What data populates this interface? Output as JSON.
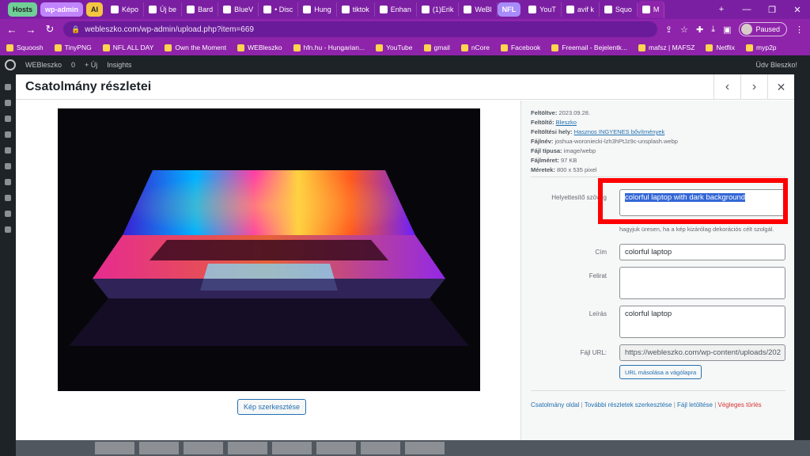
{
  "browser": {
    "tabs": [
      {
        "label": "Hosts",
        "kind": "group g1"
      },
      {
        "label": "wp-admin",
        "kind": "group g2"
      },
      {
        "label": "AI",
        "kind": "group g3"
      },
      {
        "label": "Képo",
        "kind": ""
      },
      {
        "label": "Új be",
        "kind": ""
      },
      {
        "label": "Bard",
        "kind": ""
      },
      {
        "label": "BlueV",
        "kind": ""
      },
      {
        "label": "• Disc",
        "kind": ""
      },
      {
        "label": "Hung",
        "kind": ""
      },
      {
        "label": "tiktok",
        "kind": ""
      },
      {
        "label": "Enhan",
        "kind": ""
      },
      {
        "label": "(1)Erik",
        "kind": ""
      },
      {
        "label": "WeBl",
        "kind": ""
      },
      {
        "label": "NFL",
        "kind": "group g4"
      },
      {
        "label": "YouT",
        "kind": ""
      },
      {
        "label": "avif k",
        "kind": ""
      },
      {
        "label": "Squo",
        "kind": ""
      },
      {
        "label": "M",
        "kind": "active"
      }
    ],
    "url": "webleszko.com/wp-admin/upload.php?item=669",
    "profile_status": "Paused",
    "bookmarks": [
      "Squoosh",
      "TinyPNG",
      "NFL ALL DAY",
      "Own the Moment",
      "WEBleszko",
      "hfn.hu - Hungarian...",
      "YouTube",
      "gmail",
      "nCore",
      "Facebook",
      "Freemail - Bejelentk...",
      "mafsz | MAFSZ",
      "Netflix",
      "myp2p"
    ]
  },
  "wp_admin_bar": {
    "site": "WEBleszko",
    "comments": "0",
    "new_label": "+ Új",
    "insights": "Insights",
    "greeting": "Üdv Bleszko!"
  },
  "modal": {
    "title": "Csatolmány részletei",
    "edit_image_label": "Kép szerkesztése",
    "meta": {
      "uploaded_label": "Feltöltve:",
      "uploaded": "2023.09.28.",
      "uploader_label": "Feltöltő:",
      "uploader": "Bleszko",
      "uploaded_to_label": "Feltöltési hely:",
      "uploaded_to": "Hasznos INGYENES bővítmények",
      "filename_label": "Fájlnév:",
      "filename": "joshua-woroniecki-lzh3hPtJz9c-unsplash.webp",
      "filetype_label": "Fájl típusa:",
      "filetype": "image/webp",
      "filesize_label": "Fájlméret:",
      "filesize": "97 KB",
      "dimensions_label": "Méretek:",
      "dimensions": "800 x 535 pixel"
    },
    "fields": {
      "alt_label": "Helyettesítő szöveg",
      "alt_value": "colorful laptop with dark background",
      "alt_help": "hagyjuk üresen, ha a kép kizárólag dekorációs célt szolgál.",
      "title_label": "Cím",
      "title_value": "colorful laptop",
      "caption_label": "Felirat",
      "caption_value": "",
      "desc_label": "Leírás",
      "desc_value": "colorful laptop",
      "url_label": "Fájl URL:",
      "url_value": "https://webleszko.com/wp-content/uploads/202",
      "copy_label": "URL másolása a vágólapra"
    },
    "links": {
      "attachment_page": "Csatolmány oldal",
      "edit_more": "További részletek szerkesztése",
      "download": "Fájl letöltése",
      "delete": "Végleges törlés"
    }
  },
  "colors": {
    "highlight": "#ff0000",
    "wp_blue": "#2271b1",
    "chrome": "#8e24aa"
  }
}
